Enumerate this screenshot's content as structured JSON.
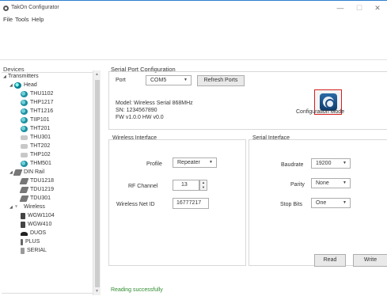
{
  "window": {
    "title": "TakOn Configurator",
    "minimize_glyph": "—",
    "maximize_glyph": "☐",
    "close_glyph": "✕"
  },
  "menu": {
    "items": [
      "File",
      "Tools",
      "Help"
    ]
  },
  "tree": {
    "title": "Devices",
    "nodes": [
      {
        "label": "Transmitters",
        "icon": "folder-icon"
      },
      {
        "label": "Head",
        "icon": "head-icon"
      },
      {
        "label": "THU1102",
        "icon": "sensor-icon"
      },
      {
        "label": "THP1217",
        "icon": "sensor-icon"
      },
      {
        "label": "THT1216",
        "icon": "sensor-icon"
      },
      {
        "label": "TIIP101",
        "icon": "sensor-icon"
      },
      {
        "label": "THT201",
        "icon": "sensor-icon"
      },
      {
        "label": "THU301",
        "icon": "probe-icon"
      },
      {
        "label": "THT202",
        "icon": "probe-icon"
      },
      {
        "label": "THP102",
        "icon": "probe-icon"
      },
      {
        "label": "THM501",
        "icon": "sensor-icon"
      },
      {
        "label": "DIN Rail",
        "icon": "rail-icon"
      },
      {
        "label": "TDU1218",
        "icon": "rail-icon"
      },
      {
        "label": "TDU1219",
        "icon": "rail-icon"
      },
      {
        "label": "TDU301",
        "icon": "rail-icon"
      },
      {
        "label": "Wireless",
        "icon": "wireless-icon"
      },
      {
        "label": "WGW1104",
        "icon": "device-icon"
      },
      {
        "label": "WGW410",
        "icon": "device-icon"
      },
      {
        "label": "DUOS",
        "icon": "duo-icon"
      },
      {
        "label": "PLUS",
        "icon": "plus-icon"
      },
      {
        "label": "SERIAL",
        "icon": "serial-icon"
      }
    ]
  },
  "serial_port": {
    "section_title": "Serial Port Configuration",
    "port_label": "Port",
    "port_value": "COM5",
    "refresh_label": "Refresh Ports",
    "model": "Model: Wireless Serial 868MHz",
    "sn": "SN: 1234567890",
    "fw": "FW v1.0.0  HW v0.0",
    "config_mode_label": "Configuration Mode"
  },
  "wireless": {
    "section_title": "Wireless Interface",
    "profile_label": "Profile",
    "profile_value": "Repeater",
    "rf_channel_label": "RF Channel",
    "rf_channel_value": "13",
    "net_id_label": "Wireless Net ID",
    "net_id_value": "16777217"
  },
  "serial_iface": {
    "section_title": "Serial Interface",
    "baudrate_label": "Baudrate",
    "baudrate_value": "19200",
    "parity_label": "Parity",
    "parity_value": "None",
    "stopbits_label": "Stop Bits",
    "stopbits_value": "One"
  },
  "actions": {
    "read_label": "Read",
    "write_label": "Write"
  },
  "status": {
    "message": "Reading successfully"
  }
}
